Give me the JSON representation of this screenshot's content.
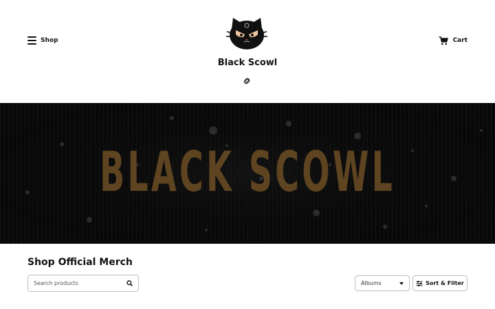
{
  "header": {
    "shop_label": "Shop",
    "cart_label": "Cart",
    "brand_name": "Black Scowl"
  },
  "icons": {
    "menu": "hamburger-icon",
    "cart": "cart-icon",
    "logo": "scowling-cat-logo",
    "link": "paperclip-link-icon",
    "search": "search-icon",
    "dropdown": "chevron-down-icon",
    "filter": "sliders-icon"
  },
  "banner": {
    "text": "BLACK SCOWL",
    "text_color": "#5e4421",
    "background_color": "#090909"
  },
  "main": {
    "section_title": "Shop Official Merch",
    "search_placeholder": "Search products",
    "category_select_value": "Albums",
    "sort_filter_label": "Sort & Filter"
  }
}
